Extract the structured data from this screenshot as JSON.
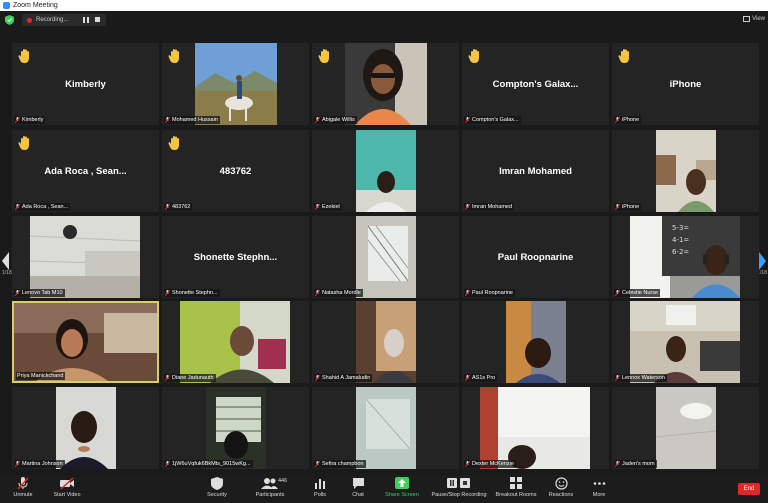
{
  "window": {
    "title": "Zoom Meeting"
  },
  "topbar": {
    "recording_label": "Recording...",
    "view_label": "View"
  },
  "navigation": {
    "page_left": "1/18",
    "page_right": "1/18"
  },
  "participants": [
    {
      "name": "Kimberly",
      "hand": true,
      "muted": true,
      "video": false
    },
    {
      "name": "Mohamed Hussain",
      "hand": true,
      "muted": true,
      "video": true,
      "scene": "horse"
    },
    {
      "name": "Abigale Willis",
      "hand": true,
      "muted": true,
      "video": true,
      "scene": "woman-sunglasses"
    },
    {
      "name": "Compton's Galax...",
      "hand": true,
      "muted": true,
      "video": false
    },
    {
      "name": "iPhone",
      "hand": true,
      "muted": true,
      "video": false
    },
    {
      "name": "Ada Roca , Sean...",
      "hand": true,
      "muted": true,
      "video": false
    },
    {
      "name": "483762",
      "hand": true,
      "muted": true,
      "video": false
    },
    {
      "name": "Ezekiel",
      "hand": false,
      "muted": true,
      "video": true,
      "scene": "teal-room"
    },
    {
      "name": "Imran Mohamed",
      "hand": false,
      "muted": true,
      "video": false
    },
    {
      "name": "iPhone",
      "hand": false,
      "muted": true,
      "video": true,
      "scene": "kitchen"
    },
    {
      "name": "Lenovo Tab M10",
      "hand": false,
      "muted": true,
      "video": true,
      "scene": "ceiling"
    },
    {
      "name": "Shonette  Stephn...",
      "hand": false,
      "muted": true,
      "video": false
    },
    {
      "name": "Natasha Mordle",
      "hand": false,
      "muted": true,
      "video": true,
      "scene": "window-blind"
    },
    {
      "name": "Paul Roopnarine",
      "hand": false,
      "muted": true,
      "video": false
    },
    {
      "name": "Celestie Nurse",
      "hand": false,
      "muted": true,
      "video": true,
      "scene": "whiteboard"
    },
    {
      "name": "Priya Manickchand",
      "hand": false,
      "muted": false,
      "video": true,
      "scene": "speaker"
    },
    {
      "name": "Diane Jadunauth",
      "hand": false,
      "muted": true,
      "video": true,
      "scene": "green-room"
    },
    {
      "name": "Shahid A Jamaludin",
      "hand": false,
      "muted": true,
      "video": true,
      "scene": "doorway"
    },
    {
      "name": "AS1s Pro",
      "hand": false,
      "muted": true,
      "video": true,
      "scene": "selfie"
    },
    {
      "name": "Lennox Waterson",
      "hand": false,
      "muted": true,
      "video": true,
      "scene": "office"
    },
    {
      "name": "Martina Johnson",
      "hand": false,
      "muted": true,
      "video": true,
      "scene": "woman-dark"
    },
    {
      "name": "1jW6uVqfuk6BkMts_9015wKg...",
      "hand": false,
      "muted": true,
      "video": true,
      "scene": "dark-window"
    },
    {
      "name": "Sefira champbon",
      "hand": false,
      "muted": true,
      "video": true,
      "scene": "wall"
    },
    {
      "name": "Dexter McKenzie",
      "hand": false,
      "muted": true,
      "video": true,
      "scene": "curtain-room"
    },
    {
      "name": "Jaden's mom",
      "hand": false,
      "muted": true,
      "video": true,
      "scene": "ceiling-light"
    }
  ],
  "toolbar": {
    "unmute": "Unmute",
    "start_video": "Start Video",
    "security": "Security",
    "participants": "Participants",
    "participants_count": "446",
    "polls": "Polls",
    "chat": "Chat",
    "share_screen": "Share Screen",
    "pause_recording": "Pause/Stop Recording",
    "breakout_rooms": "Breakout Rooms",
    "reactions": "Reactions",
    "more": "More",
    "end": "End"
  },
  "colors": {
    "accent_green": "#3ecf5a",
    "end_red": "#e02828",
    "active_speaker": "#d6ce6a",
    "hand_yellow": "#f5c542"
  }
}
